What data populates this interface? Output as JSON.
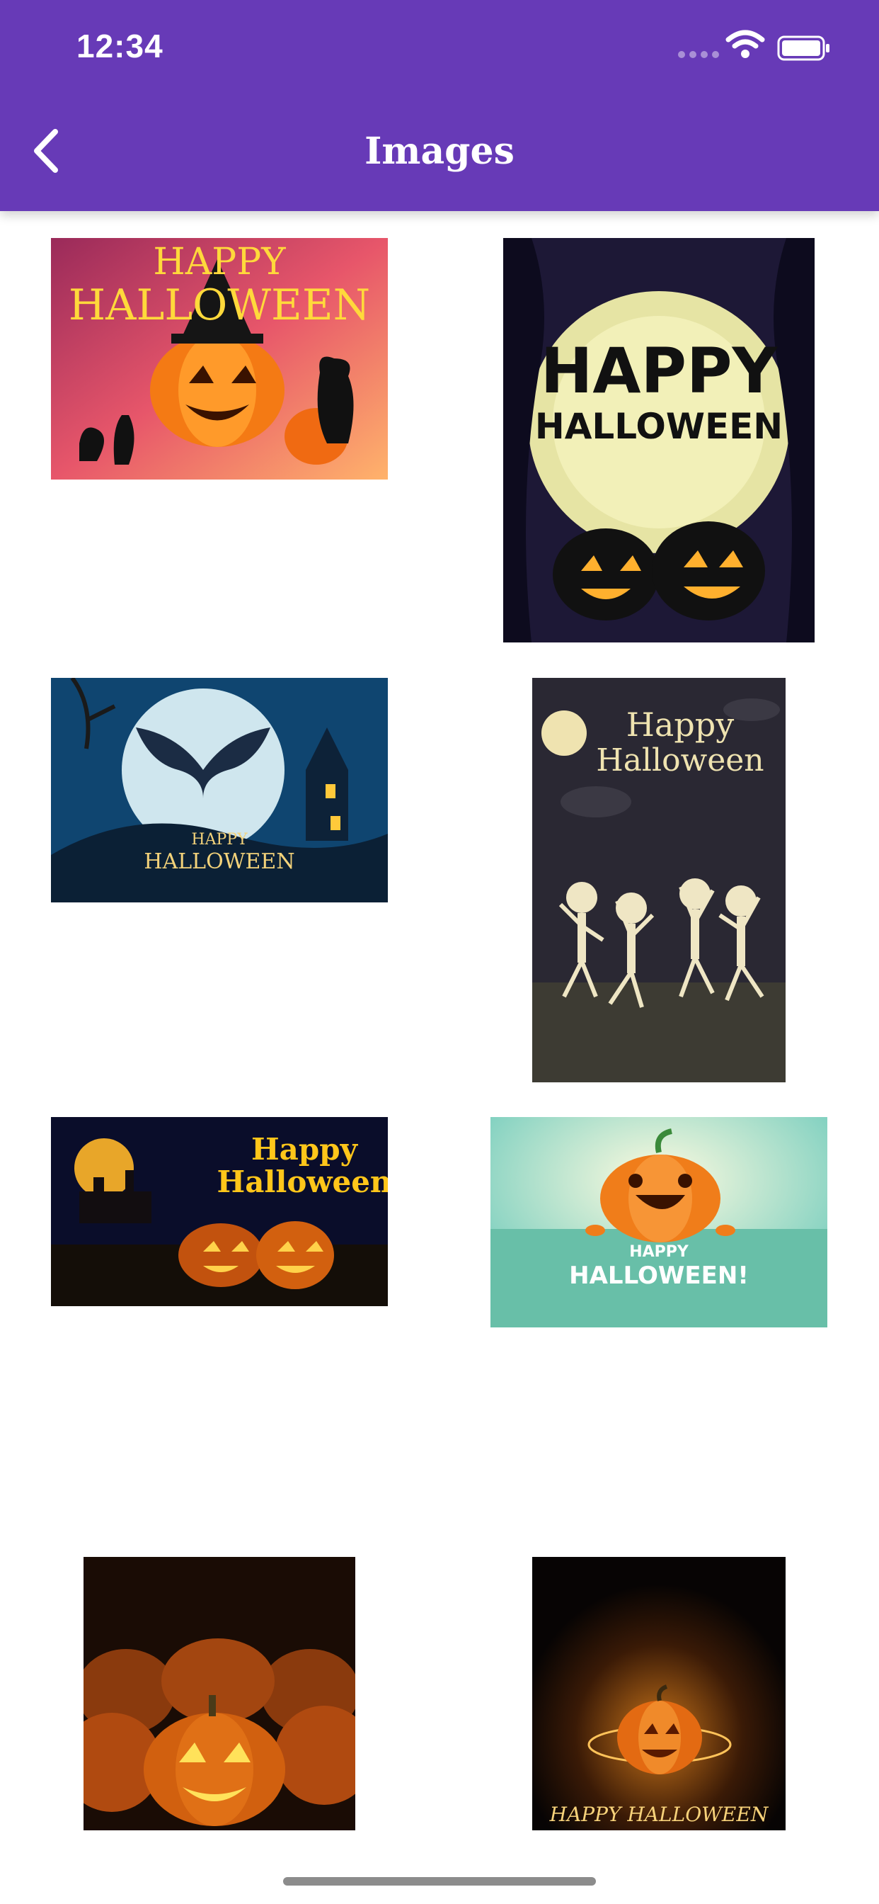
{
  "status_bar": {
    "time": "12:34"
  },
  "header": {
    "title": "Images",
    "back_icon": "chevron-left-icon"
  },
  "colors": {
    "header": "#673ab7",
    "text_on_header": "#ffffff"
  },
  "images": [
    {
      "line1": "HAPPY",
      "line2": "HALLOWEEN"
    },
    {
      "line1": "HAPPY",
      "line2": "HALLOWEEN"
    },
    {
      "line1": "HAPPY",
      "line2": "HALLOWEEN"
    },
    {
      "line1": "Happy",
      "line2": "Halloween"
    },
    {
      "line1": "Happy",
      "line2": "Halloween"
    },
    {
      "line1": "HAPPY",
      "line2": "HALLOWEEN!"
    },
    {
      "line1": "",
      "line2": ""
    },
    {
      "line1": "HAPPY HALLOWEEN",
      "line2": ""
    }
  ]
}
